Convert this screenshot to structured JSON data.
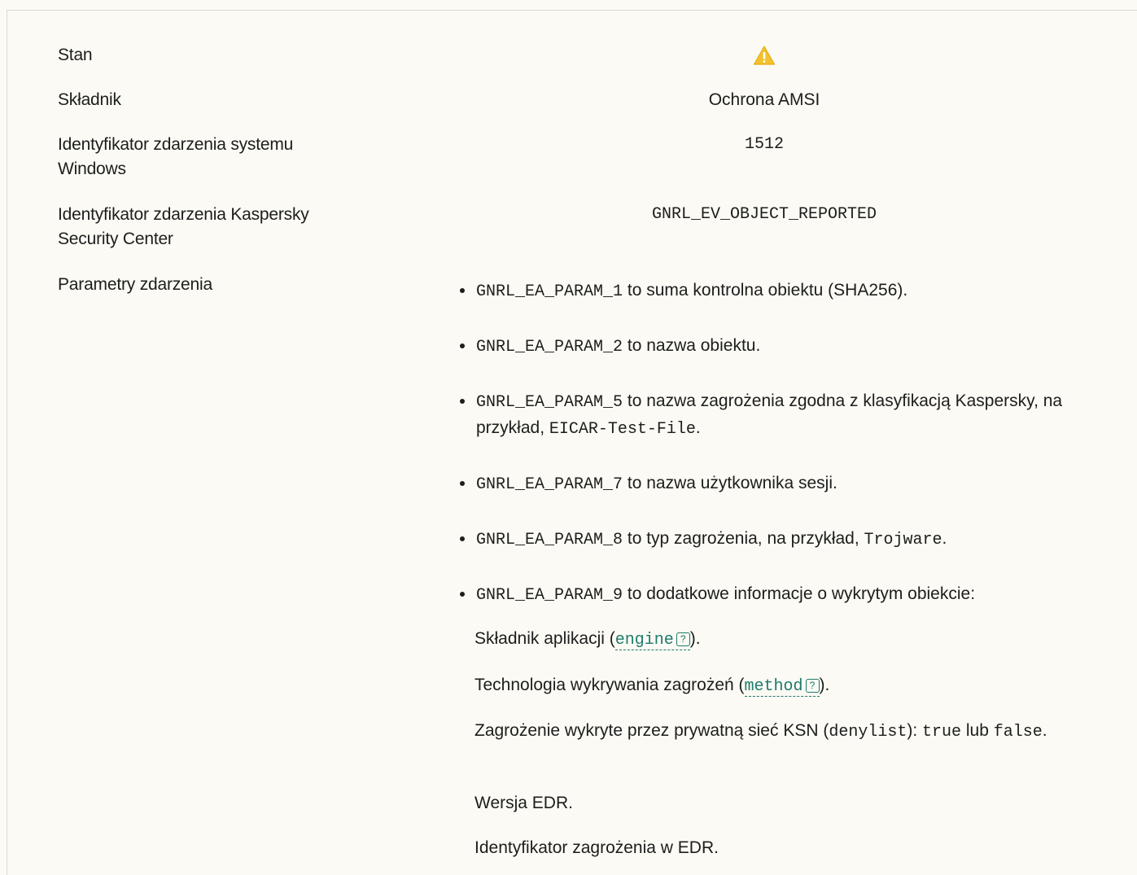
{
  "rows": {
    "stan": {
      "label": "Stan",
      "icon": "warning-triangle-icon"
    },
    "skladnik": {
      "label": "Składnik",
      "value": "Ochrona AMSI"
    },
    "win_id": {
      "label": "Identyfikator zdarzenia systemu Windows",
      "value": "1512"
    },
    "ksc_id": {
      "label": "Identyfikator zdarzenia Kaspersky Security Center",
      "value": "GNRL_EV_OBJECT_REPORTED"
    },
    "params": {
      "label": "Parametry zdarzenia"
    }
  },
  "params": [
    {
      "code": "GNRL_EA_PARAM_1",
      "text": " to suma kontrolna obiektu (SHA256)."
    },
    {
      "code": "GNRL_EA_PARAM_2",
      "text": " to nazwa obiektu."
    },
    {
      "code": "GNRL_EA_PARAM_5",
      "text": " to nazwa zagrożenia zgodna z klasyfikacją Kaspersky, na przykład, ",
      "code2": "EICAR-Test-File",
      "tail": "."
    },
    {
      "code": "GNRL_EA_PARAM_7",
      "text": " to nazwa użytkownika sesji."
    },
    {
      "code": "GNRL_EA_PARAM_8",
      "text": " to typ zagrożenia, na przykład, ",
      "code2": "Trojware",
      "tail": "."
    },
    {
      "code": "GNRL_EA_PARAM_9",
      "text": " to dodatkowe informacje o wykrytym obiekcie:"
    }
  ],
  "details": {
    "engine": {
      "before": "Składnik aplikacji (",
      "link": "engine",
      "after": ")."
    },
    "method": {
      "before": "Technologia wykrywania zagrożeń (",
      "link": "method",
      "after": ")."
    },
    "ksn": {
      "before": "Zagrożenie wykryte przez prywatną sieć KSN (",
      "code1": "denylist",
      "mid": "): ",
      "code2": "true",
      "mid2": " lub ",
      "code3": "false",
      "after": "."
    },
    "edr_version": "Wersja EDR.",
    "edr_threat": "Identyfikator zagrożenia w EDR."
  },
  "help_glyph": "?",
  "colors": {
    "warning": "#f2c12e",
    "link": "#1f7a6a",
    "background": "#fbfaf5"
  }
}
